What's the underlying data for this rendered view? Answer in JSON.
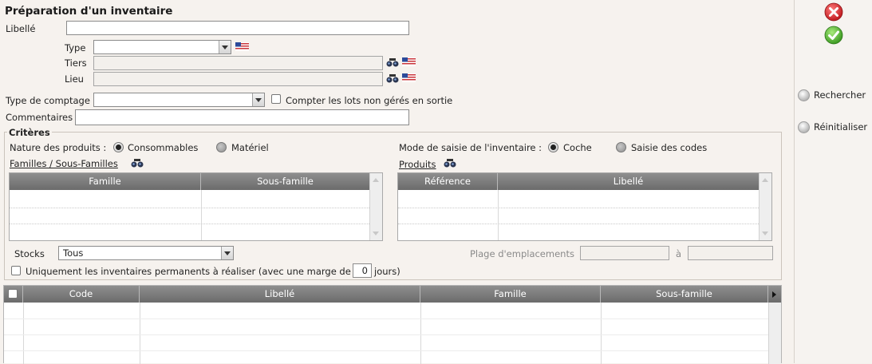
{
  "form": {
    "title": "Préparation d'un inventaire",
    "libelle_label": "Libellé",
    "libelle_value": "",
    "type_label": "Type",
    "type_value": "",
    "tiers_label": "Tiers",
    "tiers_value": "",
    "lieu_label": "Lieu",
    "lieu_value": "",
    "type_comptage_label": "Type de comptage",
    "type_comptage_value": "",
    "compter_lots_label": "Compter les lots non gérés en sortie",
    "commentaires_label": "Commentaires",
    "commentaires_value": ""
  },
  "criteres": {
    "legend": "Critères",
    "nature_label": "Nature des produits :",
    "nature_options": [
      "Consommables",
      "Matériel"
    ],
    "nature_selected": "Consommables",
    "mode_label": "Mode de saisie de l'inventaire :",
    "mode_options": [
      "Coche",
      "Saisie des codes"
    ],
    "mode_selected": "Coche",
    "familles_link": "Familles / Sous-Familles",
    "produits_link": "Produits",
    "familles_grid_headers": [
      "Famille",
      "Sous-famille"
    ],
    "produits_grid_headers": [
      "Référence",
      "Libellé"
    ],
    "stocks_label": "Stocks",
    "stocks_value": "Tous",
    "plage_label": "Plage d'emplacements",
    "plage_a_label": "à",
    "permanents_label": "Uniquement les inventaires permanents à réaliser (avec une marge de",
    "marge_value": "0",
    "jours_label": "jours)"
  },
  "results_grid": {
    "headers": [
      "Code",
      "Libellé",
      "Famille",
      "Sous-famille"
    ],
    "rows": []
  },
  "sidebar": {
    "cancel_icon": "cancel-icon",
    "validate_icon": "validate-icon",
    "rechercher_label": "Rechercher",
    "reinitialiser_label": "Réinitialiser"
  },
  "colors": {
    "grid_header": "#7c7c7c",
    "cancel": "#d4272d",
    "validate": "#4caf31",
    "background": "#f6f2ee"
  }
}
